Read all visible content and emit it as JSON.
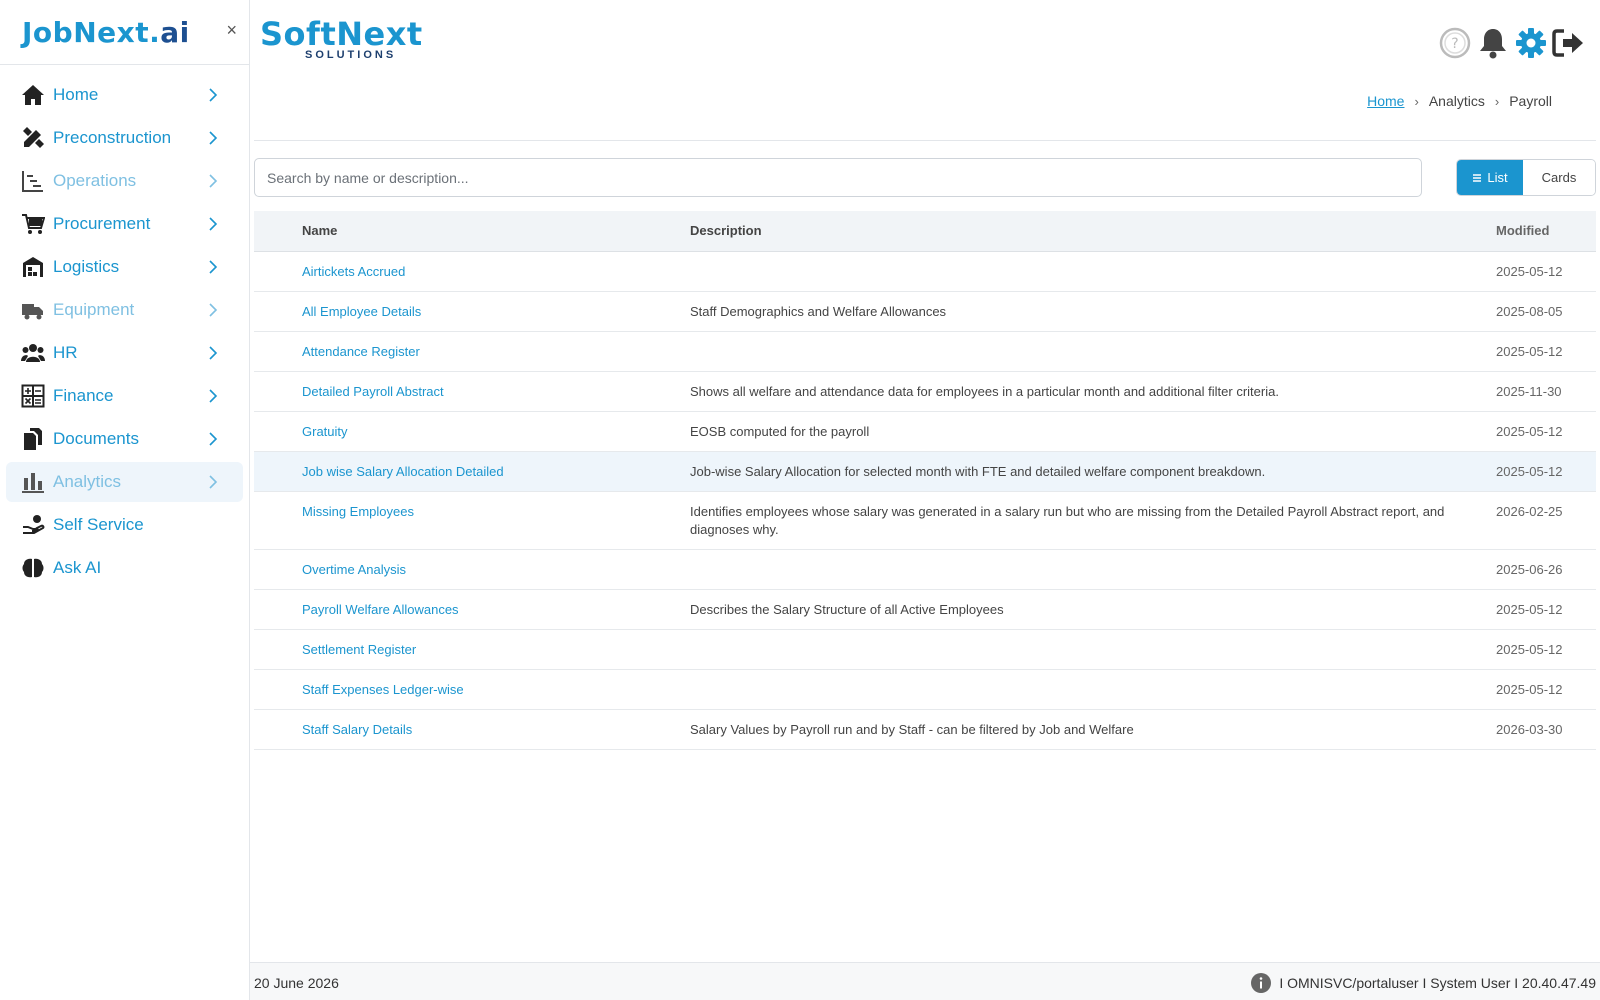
{
  "sidebar": {
    "logo": {
      "job": "Job",
      "next": "Next.",
      "ai": "ai"
    },
    "close": "×",
    "items": [
      {
        "label": "Home",
        "icon": "home-icon"
      },
      {
        "label": "Preconstruction",
        "icon": "drafting-icon"
      },
      {
        "label": "Operations",
        "icon": "gantt-icon"
      },
      {
        "label": "Procurement",
        "icon": "cart-icon"
      },
      {
        "label": "Logistics",
        "icon": "warehouse-icon"
      },
      {
        "label": "Equipment",
        "icon": "truck-icon"
      },
      {
        "label": "HR",
        "icon": "people-icon"
      },
      {
        "label": "Finance",
        "icon": "calculator-icon"
      },
      {
        "label": "Documents",
        "icon": "documents-icon"
      },
      {
        "label": "Analytics",
        "icon": "bar-chart-icon"
      },
      {
        "label": "Self Service",
        "icon": "hand-icon"
      },
      {
        "label": "Ask AI",
        "icon": "brain-icon"
      }
    ]
  },
  "header": {
    "brand": "SoftNext",
    "brand_sub": "SOLUTIONS"
  },
  "breadcrumb": {
    "home": "Home",
    "section": "Analytics",
    "current": "Payroll"
  },
  "search": {
    "placeholder": "Search by name or description..."
  },
  "view_toggle": {
    "list": "List",
    "cards": "Cards"
  },
  "table": {
    "columns": {
      "name": "Name",
      "description": "Description",
      "modified": "Modified"
    },
    "rows": [
      {
        "name": "Airtickets Accrued",
        "description": "",
        "modified": "2025-05-12"
      },
      {
        "name": "All Employee Details",
        "description": "Staff Demographics and Welfare Allowances",
        "modified": "2025-08-05"
      },
      {
        "name": "Attendance Register",
        "description": "",
        "modified": "2025-05-12"
      },
      {
        "name": "Detailed Payroll Abstract",
        "description": "Shows all welfare and attendance data for employees in a particular month and additional filter criteria.",
        "modified": "2025-11-30"
      },
      {
        "name": "Gratuity",
        "description": "EOSB computed for the payroll",
        "modified": "2025-05-12"
      },
      {
        "name": "Job wise Salary Allocation Detailed",
        "description": "Job-wise Salary Allocation for selected month with FTE and detailed welfare component breakdown.",
        "modified": "2025-05-12"
      },
      {
        "name": "Missing Employees",
        "description": "Identifies employees whose salary was generated in a salary run but who are missing from the Detailed Payroll Abstract report, and diagnoses why.",
        "modified": "2026-02-25"
      },
      {
        "name": "Overtime Analysis",
        "description": "",
        "modified": "2025-06-26"
      },
      {
        "name": "Payroll Welfare Allowances",
        "description": "Describes the Salary Structure of all Active Employees",
        "modified": "2025-05-12"
      },
      {
        "name": "Settlement Register",
        "description": "",
        "modified": "2025-05-12"
      },
      {
        "name": "Staff Expenses Ledger-wise",
        "description": "",
        "modified": "2025-05-12"
      },
      {
        "name": "Staff Salary Details",
        "description": "Salary Values by Payroll run and by Staff - can be filtered by Job and Welfare",
        "modified": "2026-03-30"
      }
    ]
  },
  "footer": {
    "date": "20 June 2026",
    "session": "I OMNISVC/portaluser I System User I 20.40.47.49"
  },
  "colors": {
    "accent": "#1b95cf",
    "brand_dark": "#1d4f91",
    "active_bg": "#eef5fb"
  }
}
